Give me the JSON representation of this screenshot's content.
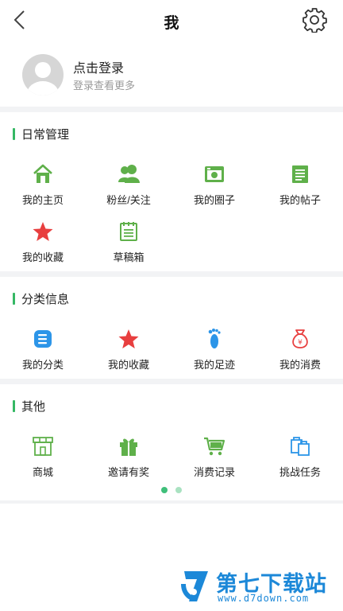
{
  "header": {
    "title": "我"
  },
  "profile": {
    "title": "点击登录",
    "subtitle": "登录查看更多"
  },
  "sections": [
    {
      "title": "日常管理",
      "items": [
        {
          "label": "我的主页",
          "icon": "home-icon"
        },
        {
          "label": "粉丝/关注",
          "icon": "fans-icon"
        },
        {
          "label": "我的圈子",
          "icon": "circle-icon"
        },
        {
          "label": "我的帖子",
          "icon": "post-icon"
        },
        {
          "label": "我的收藏",
          "icon": "star-icon"
        },
        {
          "label": "草稿箱",
          "icon": "draft-icon"
        }
      ]
    },
    {
      "title": "分类信息",
      "items": [
        {
          "label": "我的分类",
          "icon": "category-icon"
        },
        {
          "label": "我的收藏",
          "icon": "star-icon"
        },
        {
          "label": "我的足迹",
          "icon": "footprint-icon"
        },
        {
          "label": "我的消费",
          "icon": "money-bag-icon"
        }
      ]
    },
    {
      "title": "其他",
      "items": [
        {
          "label": "商城",
          "icon": "shop-icon"
        },
        {
          "label": "邀请有奖",
          "icon": "gift-icon"
        },
        {
          "label": "消费记录",
          "icon": "cart-icon"
        },
        {
          "label": "挑战任务",
          "icon": "bags-icon"
        }
      ]
    }
  ],
  "pager": {
    "pages": 2,
    "active": 1
  },
  "watermark": {
    "name": "第七下载站",
    "url": "www.d7down.com"
  },
  "colors": {
    "accent": "#35b864",
    "green": "#5fb04a",
    "red": "#e83f3f",
    "blue": "#2c95e8",
    "divider": "#f2f3f5"
  }
}
